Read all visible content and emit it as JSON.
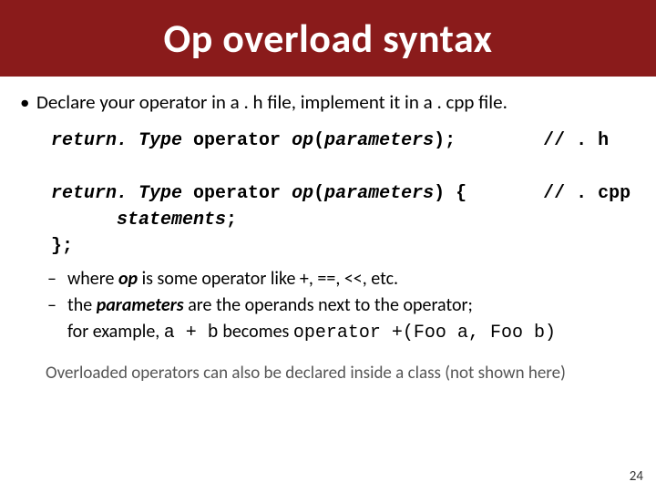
{
  "title": "Op overload syntax",
  "bullet_dot": "•",
  "bullet_main": "Declare your operator in a . h file,  implement it in a . cpp file.",
  "code": {
    "l1_a": "return. Type",
    "l1_b": " operator ",
    "l1_c": "op",
    "l1_d": "(",
    "l1_e": "parameters",
    "l1_f": ");        ",
    "l1_g": "// . h",
    "blank": " ",
    "l2_a": "return. Type",
    "l2_b": " operator ",
    "l2_c": "op",
    "l2_d": "(",
    "l2_e": "parameters",
    "l2_f": ") {       ",
    "l2_g": "// . cpp",
    "l3_a": "      ",
    "l3_b": "statements",
    "l3_c": ";",
    "l4": "};"
  },
  "dash": "–",
  "sub1_a": "where ",
  "sub1_b": "op",
  "sub1_c": " is some operator like +, ==, <<, etc.",
  "sub2_a": "the ",
  "sub2_b": "parameters",
  "sub2_c": " are the operands next to the operator;",
  "sub2_line2_a": "for example, ",
  "sub2_line2_b": "a + b",
  "sub2_line2_c": "  becomes  ",
  "sub2_line2_d": "operator +(Foo a, Foo b)",
  "footnote": "Overloaded operators can also be declared inside a class (not shown here)",
  "pagenum": "24"
}
